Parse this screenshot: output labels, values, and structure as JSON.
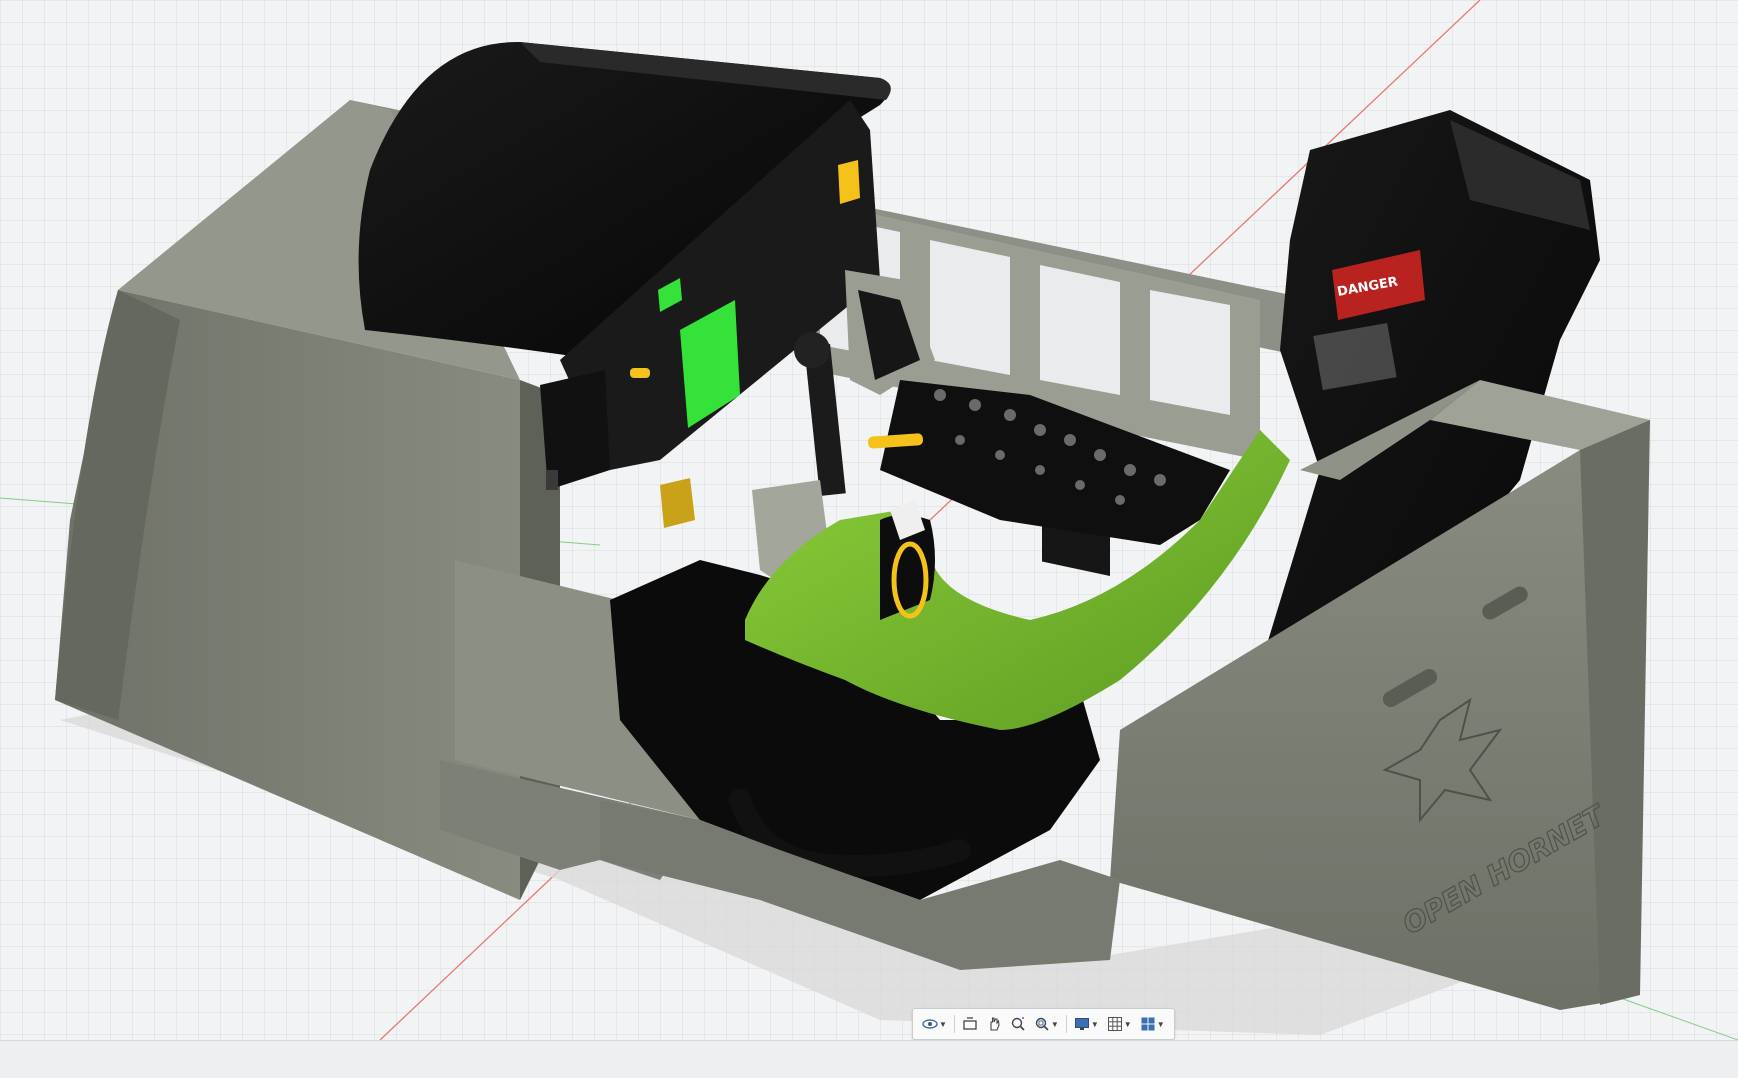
{
  "viewport": {
    "grid": true,
    "background": "#f2f3f4",
    "model": {
      "logo_text": "OPEN HORNET",
      "placard_warning": "DANGER",
      "colors": {
        "frame_gray": "#7b7e73",
        "frame_dark": "#5f6259",
        "panel_black": "#0c0c0c",
        "seat_green": "#74b72e",
        "mfd_green": "#35e23a",
        "handle_yellow": "#f4c21b",
        "danger_red": "#b8231f",
        "axis_red": "#e0493f",
        "axis_green": "#5cbf5c"
      }
    }
  },
  "toolbar": {
    "buttons": [
      {
        "icon": "orbit-icon",
        "has_dropdown": true
      },
      {
        "icon": "look-at-icon",
        "has_dropdown": false
      },
      {
        "icon": "pan-icon",
        "has_dropdown": false
      },
      {
        "icon": "zoom-icon",
        "has_dropdown": false
      },
      {
        "icon": "fit-icon",
        "has_dropdown": true
      },
      {
        "icon": "display-settings-icon",
        "has_dropdown": true
      },
      {
        "icon": "grid-snaps-icon",
        "has_dropdown": true
      },
      {
        "icon": "viewports-icon",
        "has_dropdown": true
      }
    ]
  }
}
